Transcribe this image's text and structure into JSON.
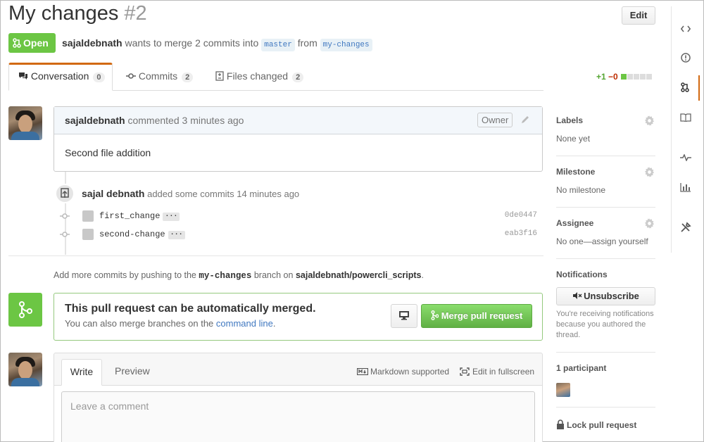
{
  "header": {
    "title": "My changes",
    "number": "#2",
    "edit_label": "Edit",
    "state_label": "Open",
    "author": "sajaldebnath",
    "merge_text": "wants to merge 2 commits into",
    "base_branch": "master",
    "from_text": "from",
    "head_branch": "my-changes"
  },
  "tabs": [
    {
      "label": "Conversation",
      "count": "0"
    },
    {
      "label": "Commits",
      "count": "2"
    },
    {
      "label": "Files changed",
      "count": "2"
    }
  ],
  "diffstat": {
    "additions": "+1",
    "deletions": "−0"
  },
  "comment": {
    "author": "sajaldebnath",
    "meta": "commented 3 minutes ago",
    "role": "Owner",
    "body": "Second file addition"
  },
  "commits_event": {
    "author": "sajal debnath",
    "text": "added some commits 14 minutes ago",
    "commits": [
      {
        "message": "first_change",
        "sha": "0de0447"
      },
      {
        "message": "second-change",
        "sha": "eab3f16"
      }
    ],
    "ellipsis": "···"
  },
  "push_hint": {
    "prefix": "Add more commits by pushing to the",
    "branch": "my-changes",
    "middle": "branch on",
    "repo": "sajaldebnath/powercli_scripts",
    "suffix": "."
  },
  "merge": {
    "title": "This pull request can be automatically merged.",
    "sub_prefix": "You can also merge branches on the",
    "sub_link": "command line",
    "sub_suffix": ".",
    "button_label": "Merge pull request"
  },
  "write": {
    "write_tab": "Write",
    "preview_tab": "Preview",
    "markdown_label": "Markdown supported",
    "fullscreen_label": "Edit in fullscreen",
    "placeholder": "Leave a comment"
  },
  "sidebar": {
    "labels_heading": "Labels",
    "labels_value": "None yet",
    "milestone_heading": "Milestone",
    "milestone_value": "No milestone",
    "assignee_heading": "Assignee",
    "assignee_value": "No one—assign yourself",
    "notifications_heading": "Notifications",
    "unsubscribe_label": "Unsubscribe",
    "notifications_note": "You're receiving notifications because you authored the thread.",
    "participants_heading": "1 participant",
    "lock_label": "Lock pull request"
  },
  "colors": {
    "open_green": "#6cc644",
    "accent_orange": "#d26911",
    "link_blue": "#4078c0"
  }
}
